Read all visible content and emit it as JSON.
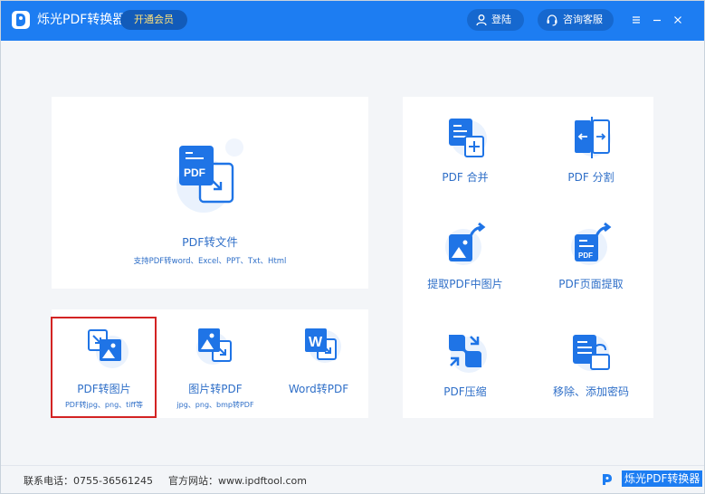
{
  "titlebar": {
    "app_title": "烁光PDF转换器",
    "vip_label": "开通会员",
    "login_label": "登陆",
    "service_label": "咨询客服",
    "menu_icon": "menu-icon",
    "minimize_icon": "minimize-icon",
    "close_icon": "close-icon"
  },
  "main_feature": {
    "title": "PDF转文件",
    "subtitle": "支持PDF转word、Excel、PPT、Txt、Html",
    "icon_text": "PDF",
    "icon": "pdf-to-file-icon"
  },
  "small_features": [
    {
      "title": "PDF转图片",
      "subtitle": "PDF转jpg、png、tiff等",
      "icon": "pdf-to-image-icon"
    },
    {
      "title": "图片转PDF",
      "subtitle": "jpg、png、bmp转PDF",
      "icon": "image-to-pdf-icon"
    },
    {
      "title": "Word转PDF",
      "subtitle": "",
      "icon": "word-to-pdf-icon",
      "icon_text": "W"
    }
  ],
  "grid_features": [
    {
      "title": "PDF 合并",
      "icon": "pdf-merge-icon"
    },
    {
      "title": "PDF 分割",
      "icon": "pdf-split-icon"
    },
    {
      "title": "提取PDF中图片",
      "icon": "extract-images-icon"
    },
    {
      "title": "PDF页面提取",
      "icon": "extract-pages-icon",
      "icon_text": "PDF"
    },
    {
      "title": "PDF压缩",
      "icon": "pdf-compress-icon"
    },
    {
      "title": "移除、添加密码",
      "icon": "password-icon"
    }
  ],
  "footer": {
    "phone": "联系电话：0755-36561245",
    "website": "官方网站：www.ipdftool.com",
    "brand": "烁光PDF转换器"
  },
  "colors": {
    "brand_blue": "#1d7df2",
    "icon_blue": "#1f74e6",
    "icon_light": "#dbe9fb",
    "label_blue": "#2f6fc8",
    "selection_red": "#d32323",
    "vip_text": "#ffe27a"
  }
}
